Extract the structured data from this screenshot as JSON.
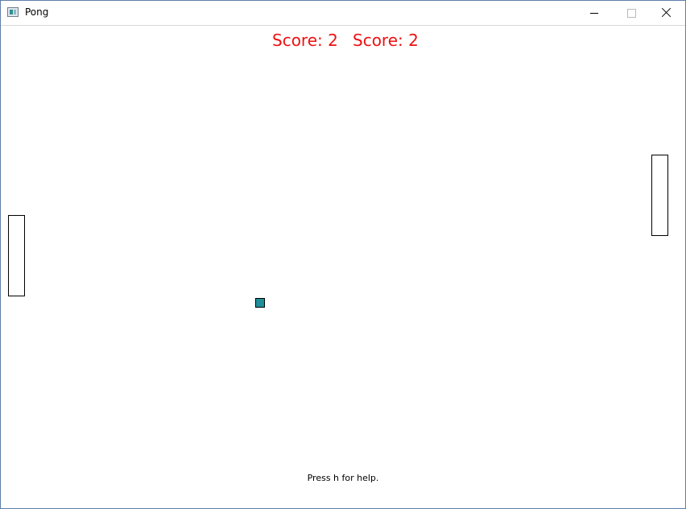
{
  "window": {
    "title": "Pong",
    "icon": "app-icon",
    "controls": {
      "minimize": "minimize-icon",
      "maximize": "maximize-icon",
      "close": "close-icon"
    }
  },
  "game": {
    "score_left": "Score: 2",
    "score_right": "Score: 2",
    "score_color": "#ee1111",
    "ball_color": "#1f8f98",
    "help_text": "Press h for help."
  }
}
